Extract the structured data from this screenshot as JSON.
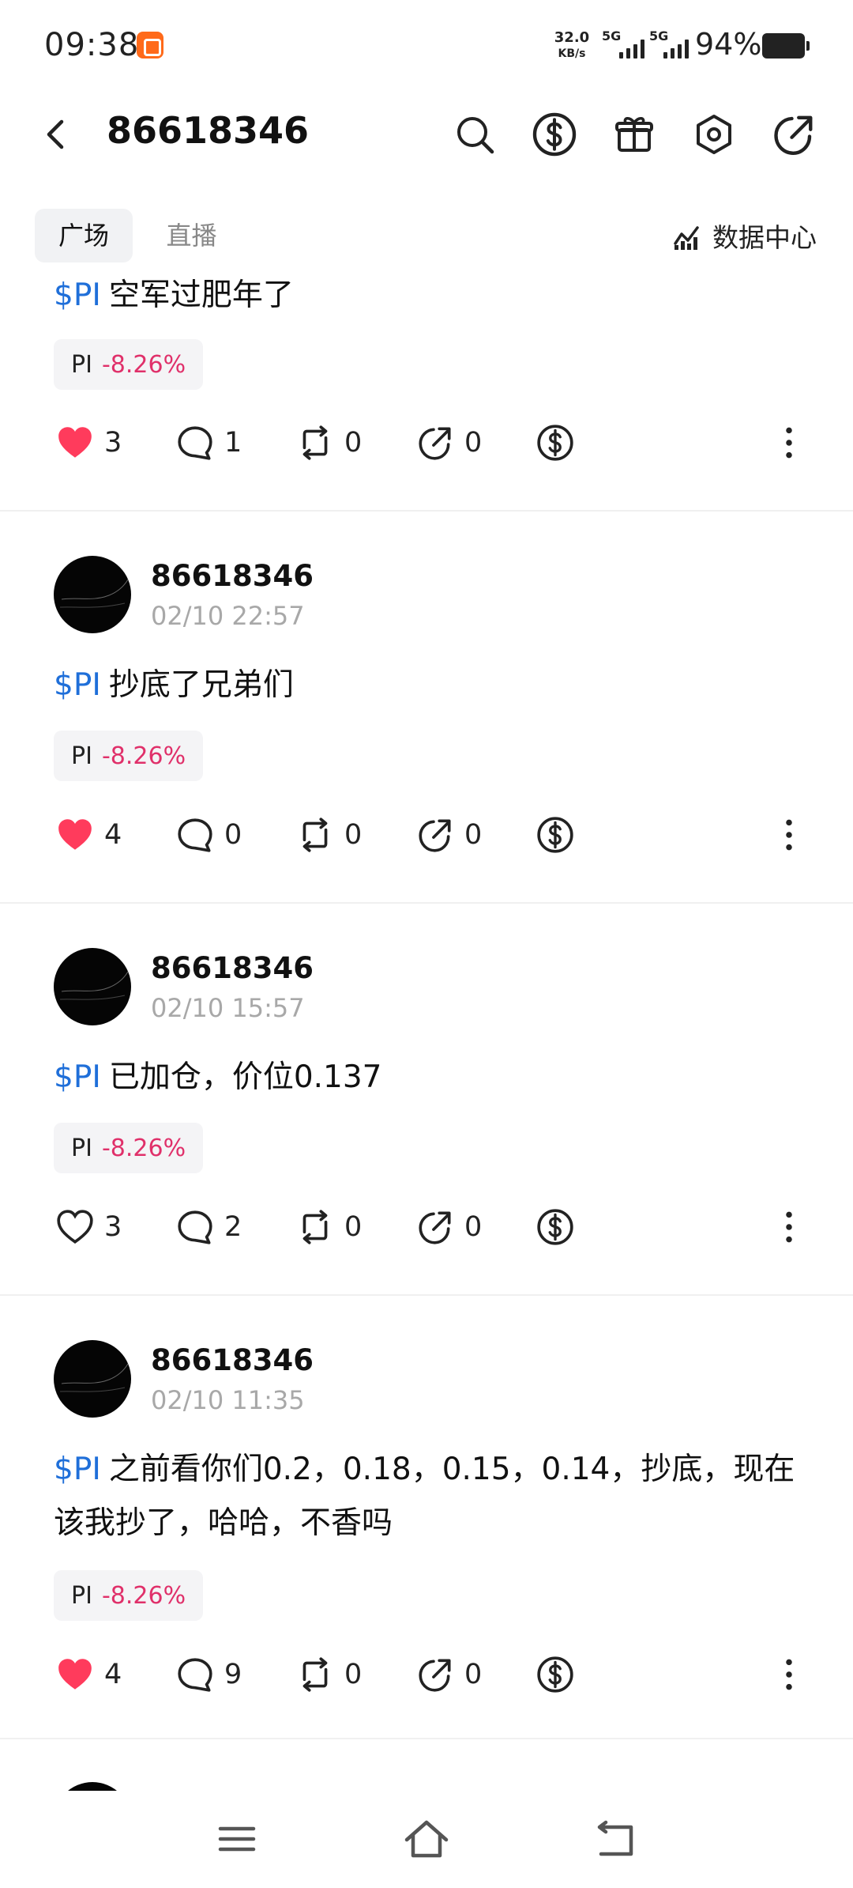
{
  "status_bar": {
    "time": "09:38",
    "speed_value": "32.0",
    "speed_unit": "KB/s",
    "network_1": "5G",
    "network_2": "5G",
    "battery": "94%"
  },
  "header": {
    "title": "86618346",
    "icons": [
      "search-icon",
      "dollar-icon",
      "gift-icon",
      "settings-icon",
      "share-icon"
    ]
  },
  "tabs": {
    "square": "广场",
    "live": "直播",
    "data_center": "数据中心"
  },
  "posts": [
    {
      "ticker": "$PI",
      "text": "空军过肥年了",
      "chip_name": "PI",
      "chip_change": "-8.26%",
      "likes": "3",
      "liked": true,
      "comments": "1",
      "reposts": "0",
      "shares": "0"
    },
    {
      "username": "86618346",
      "time": "02/10 22:57",
      "ticker": "$PI",
      "text": "抄底了兄弟们",
      "chip_name": "PI",
      "chip_change": "-8.26%",
      "likes": "4",
      "liked": true,
      "comments": "0",
      "reposts": "0",
      "shares": "0"
    },
    {
      "username": "86618346",
      "time": "02/10 15:57",
      "ticker": "$PI",
      "text": "已加仓，价位0.137",
      "chip_name": "PI",
      "chip_change": "-8.26%",
      "likes": "3",
      "liked": false,
      "comments": "2",
      "reposts": "0",
      "shares": "0"
    },
    {
      "username": "86618346",
      "time": "02/10 11:35",
      "ticker": "$PI",
      "text": "之前看你们0.2，0.18，0.15，0.14，抄底，现在该我抄了，哈哈，不香吗",
      "chip_name": "PI",
      "chip_change": "-8.26%",
      "likes": "4",
      "liked": true,
      "comments": "9",
      "reposts": "0",
      "shares": "0"
    }
  ],
  "colors": {
    "ticker": "#1f6fd9",
    "change_negative": "#e0306a",
    "heart_liked": "#ff3b5c",
    "chip_bg": "#f4f4f6"
  }
}
